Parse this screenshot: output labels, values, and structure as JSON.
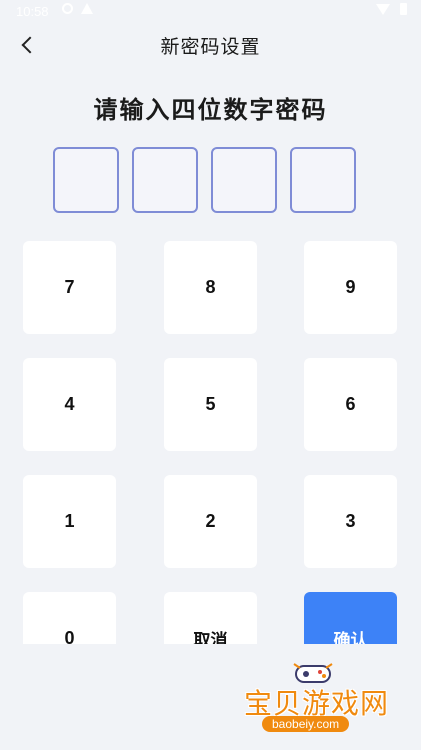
{
  "status_bar": {
    "time": "10:58",
    "icons": [
      "gear-icon",
      "alert-icon",
      "wifi-icon",
      "battery-icon"
    ]
  },
  "header": {
    "back_icon": "chevron-left-icon",
    "title": "新密码设置"
  },
  "prompt": "请输入四位数字密码",
  "pin": {
    "length": 4,
    "entered": ""
  },
  "keypad": {
    "keys": [
      "7",
      "8",
      "9",
      "4",
      "5",
      "6",
      "1",
      "2",
      "3",
      "0"
    ],
    "cancel_label": "取消",
    "confirm_label": "确认"
  },
  "watermark": {
    "title": "宝贝游戏网",
    "url": "baobeiy.com",
    "mascot_icon": "gamepad-icon"
  },
  "colors": {
    "background": "#f1f3f7",
    "pin_border": "#7f8cd6",
    "confirm": "#3d82f7",
    "watermark": "#f08a0f"
  }
}
